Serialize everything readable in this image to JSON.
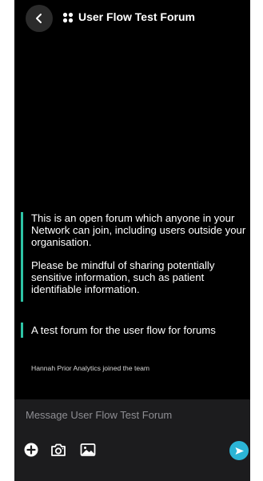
{
  "header": {
    "title": "User Flow Test Forum",
    "back_icon": "chevron-left-icon",
    "forum_icon": "four-dots-icon"
  },
  "messages": {
    "info": {
      "paragraph1": "This is an open forum which anyone in your Network can join, including users outside your organisation.",
      "paragraph2": "Please be mindful of sharing potentially sensitive information, such as patient identifiable information."
    },
    "description": "A test forum for the user flow for forums",
    "system": "Hannah Prior Analytics joined the team"
  },
  "composer": {
    "placeholder": "Message User Flow Test Forum",
    "tools": [
      "plus-circle-icon",
      "camera-icon",
      "image-icon"
    ],
    "send_icon": "send-icon"
  },
  "colors": {
    "background": "#000000",
    "accent": "#2ec4a6",
    "send": "#2bb5d6",
    "composer_bg": "#1c1c1e"
  }
}
